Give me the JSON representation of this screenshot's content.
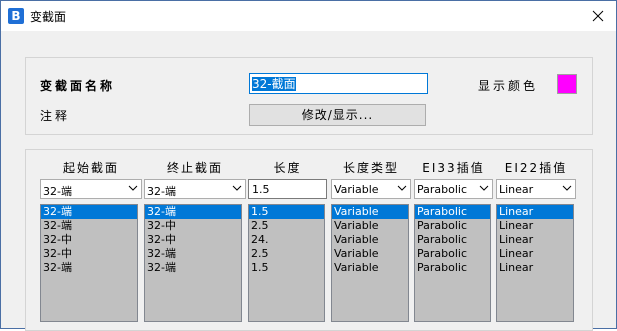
{
  "window": {
    "title": "变截面",
    "app_icon": "B"
  },
  "top": {
    "name_label": "变截面名称",
    "name_value": "32-截面",
    "display_color_label": "显示颜色",
    "display_color": "#ff00ff",
    "comment_label": "注释",
    "modify_button": "修改/显示..."
  },
  "columns": [
    {
      "header": "起始截面",
      "combo": "32-端",
      "items": [
        "32-端",
        "32-端",
        "32-中",
        "32-中",
        "32-端"
      ]
    },
    {
      "header": "终止截面",
      "combo": "32-端",
      "items": [
        "32-端",
        "32-中",
        "32-中",
        "32-端",
        "32-端"
      ]
    },
    {
      "header": "长度",
      "input": "1.5",
      "items": [
        "1.5",
        "2.5",
        "24.",
        "2.5",
        "1.5"
      ]
    },
    {
      "header": "长度类型",
      "combo": "Variable",
      "items": [
        "Variable",
        "Variable",
        "Variable",
        "Variable",
        "Variable"
      ]
    },
    {
      "header": "EI33插值",
      "combo": "Parabolic",
      "items": [
        "Parabolic",
        "Parabolic",
        "Parabolic",
        "Parabolic",
        "Parabolic"
      ]
    },
    {
      "header": "EI22插值",
      "combo": "Linear",
      "items": [
        "Linear",
        "Linear",
        "Linear",
        "Linear",
        "Linear"
      ]
    }
  ]
}
